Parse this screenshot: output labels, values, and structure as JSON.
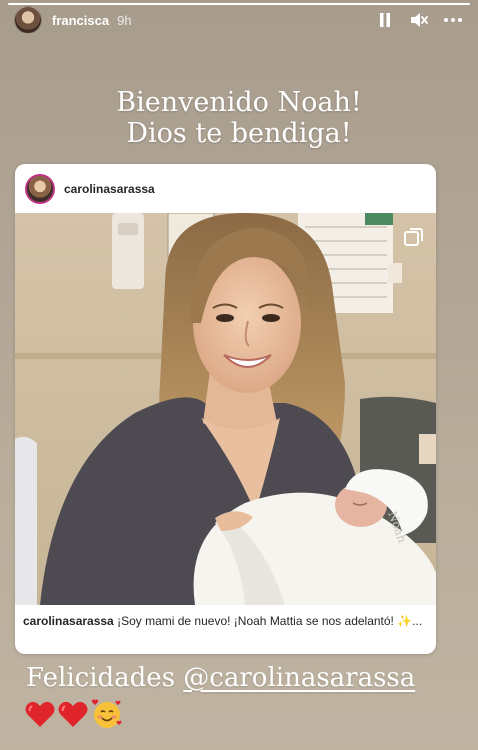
{
  "story": {
    "progress_fraction": 1.0,
    "username": "francisca",
    "time": "9h",
    "greeting_line1": "Bienvenido Noah!",
    "greeting_line2": "Dios te bendiga!",
    "footer_prefix": "Felicidades",
    "footer_mention": "@carolinasarassa",
    "footer_emojis": [
      "red-heart-icon",
      "red-heart-icon",
      "smiling-face-with-hearts-icon"
    ]
  },
  "controls": {
    "icons": [
      "pause-icon",
      "mute-icon",
      "more-options-icon"
    ]
  },
  "post": {
    "username": "carolinasarassa",
    "caption_user": "carolinasarassa",
    "caption_text": "¡Soy mami de nuevo! ¡Noah Mattia se nos adelantó! ✨...",
    "multi_photo_icon": "multiple-photos-icon"
  },
  "colors": {
    "story_background": "#b1a595",
    "card_background": "#ffffff",
    "text_on_story": "#ffffff",
    "heart": "#e0242b"
  }
}
